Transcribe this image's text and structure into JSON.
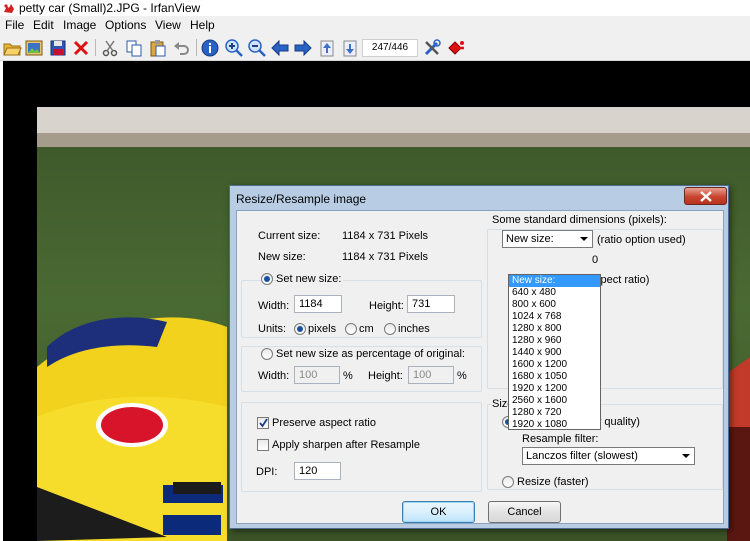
{
  "window": {
    "title": "petty car (Small)2.JPG - IrfanView"
  },
  "menu": [
    "File",
    "Edit",
    "Image",
    "Options",
    "View",
    "Help"
  ],
  "toolbar": {
    "page_counter": "247/446",
    "icons": [
      "open-folder-icon",
      "thumbnails-icon",
      "save-icon",
      "delete-icon",
      "cut-icon",
      "copy-icon",
      "paste-icon",
      "undo-icon",
      "info-icon",
      "zoom-in-icon",
      "zoom-out-icon",
      "previous-arrow-icon",
      "next-arrow-icon",
      "page-up-icon",
      "page-down-icon",
      "settings-tools-icon",
      "exit-icon"
    ]
  },
  "dialog": {
    "title": "Resize/Resample image",
    "current_size_label": "Current size:",
    "current_size_value": "1184  x  731  Pixels",
    "new_size_label": "New size:",
    "new_size_value": "1184  x  731  Pixels",
    "set_new_size_label": "Set new size:",
    "width_label": "Width:",
    "width_value": "1184",
    "height_label": "Height:",
    "height_value": "731",
    "units_label": "Units:",
    "units": [
      "pixels",
      "cm",
      "inches"
    ],
    "selected_unit": "pixels",
    "percent_label": "Set new size as percentage of original:",
    "pct_width_label": "Width:",
    "pct_width_value": "100",
    "pct_height_label": "Height:",
    "pct_height_value": "100",
    "percent_sign": "%",
    "preserve_aspect_label": "Preserve aspect ratio",
    "preserve_aspect_checked": true,
    "sharpen_label": "Apply sharpen after Resample",
    "sharpen_checked": false,
    "dpi_label": "DPI:",
    "dpi_value": "120",
    "standard_dims_label": "Some standard dimensions (pixels):",
    "standard_dims_selected": "New size:",
    "ratio_option_label": "(ratio option used)",
    "aspect_partial_label": "spect ratio)",
    "hidden_partial_label": "0",
    "standard_dims_options": [
      "New size:",
      "640 x 480",
      "800 x 600",
      "1024 x 768",
      "1280 x 800",
      "1280 x 960",
      "1440 x 900",
      "1600 x 1200",
      "1680 x 1050",
      "1920 x 1200",
      "2560 x 1600",
      "1280 x 720",
      "1920 x 1080"
    ],
    "size_method_label": "Size method:",
    "resample_label": "Resample (better quality)",
    "resample_filter_label": "Resample filter:",
    "resample_filter_value": "Lanczos filter (slowest)",
    "resize_label": "Resize (faster)",
    "ok_label": "OK",
    "cancel_label": "Cancel"
  }
}
